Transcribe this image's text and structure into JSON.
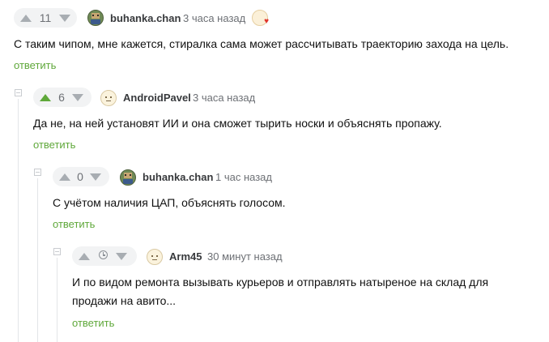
{
  "comments": [
    {
      "votes": "11",
      "author": "buhanka.chan",
      "time": "3 часа назад",
      "lines": [
        "С таким чипом, мне кажется, стиралка сама может рассчитывать траекторию захода на цель."
      ],
      "reply_label": "ответить",
      "avatar_icon": "pixel-avatar-icon",
      "badge_icon": "heart-award-icon"
    },
    {
      "votes": "6",
      "author": "AndroidPavel",
      "time": "3 часа назад",
      "lines": [
        "Да не, на ней установят ИИ и она сможет тырить носки и объяснять пропажу."
      ],
      "reply_label": "ответить",
      "avatar_icon": "default-avatar-icon",
      "upvoted": true
    },
    {
      "votes": "0",
      "author": "buhanka.chan",
      "time": "1 час назад",
      "lines": [
        "С учётом наличия ЦАП, объяснять голосом."
      ],
      "reply_label": "ответить",
      "avatar_icon": "pixel-avatar-icon"
    },
    {
      "votes_icon": "clock-icon",
      "author": "Arm45",
      "time": "30 минут назад",
      "lines": [
        "И по видом ремонта вызывать курьеров и отправлять натыреное на склад для",
        "продажи на авито..."
      ],
      "reply_label": "ответить",
      "avatar_icon": "default-avatar-icon"
    }
  ],
  "colors": {
    "accent_green": "#5fa83a",
    "vote_bg": "#f2f3f4",
    "arrow_gray": "#a8adb2",
    "thread_line": "#e3e5e8"
  }
}
